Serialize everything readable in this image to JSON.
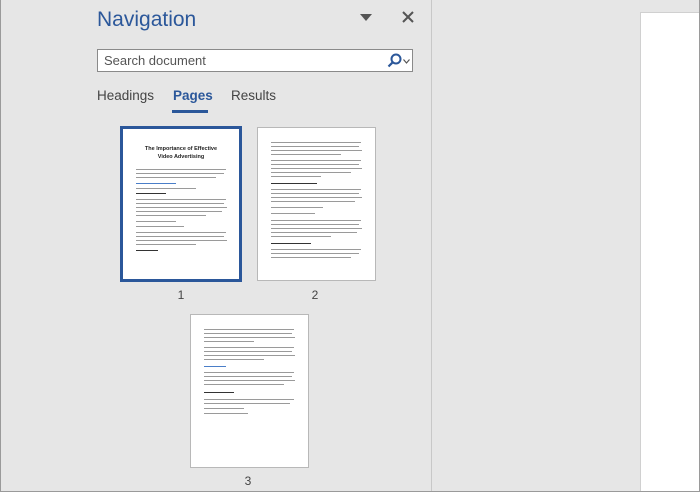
{
  "nav": {
    "title": "Navigation",
    "search_placeholder": "Search document",
    "tabs": [
      {
        "label": "Headings",
        "active": false
      },
      {
        "label": "Pages",
        "active": true
      },
      {
        "label": "Results",
        "active": false
      }
    ]
  },
  "pages": [
    {
      "number": "1",
      "title": "The Importance of Effective Video Advertising",
      "selected": true
    },
    {
      "number": "2",
      "title": "",
      "selected": false
    },
    {
      "number": "3",
      "title": "",
      "selected": false
    }
  ],
  "colors": {
    "accent": "#2b579a",
    "pane_bg": "#e6e6e6"
  },
  "icons": {
    "menu": "chevron-down-icon",
    "close": "close-icon",
    "search": "search-icon"
  }
}
